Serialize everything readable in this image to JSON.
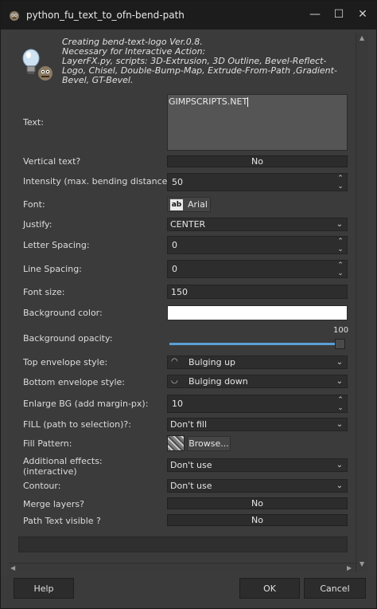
{
  "window": {
    "title": "python_fu_text_to_ofn-bend-path"
  },
  "info": {
    "text": "Creating bend-text-logo Ver.0.8.\nNecessary for Interactive Action:\nLayerFX.py, scripts: 3D-Extrusion, 3D Outline, Bevel-Reflect-\nLogo, Chisel, Double-Bump-Map, Extrude-From-Path ,Gradient-\nBevel, GT-Bevel."
  },
  "fields": {
    "text": {
      "label": "Text:",
      "value": "GIMPSCRIPTS.NET"
    },
    "vertical": {
      "label": "Vertical text?",
      "value": "No"
    },
    "intensity": {
      "label": "Intensity (max. bending distance):",
      "value": "50"
    },
    "font": {
      "label": "Font:",
      "icon_text": "ab",
      "value": "Arial"
    },
    "justify": {
      "label": "Justify:",
      "value": "CENTER"
    },
    "letter_spacing": {
      "label": "Letter Spacing:",
      "value": "0"
    },
    "line_spacing": {
      "label": "Line Spacing:",
      "value": "0"
    },
    "font_size": {
      "label": "Font size:",
      "value": "150"
    },
    "bg_color": {
      "label": "Background color:",
      "color": "#ffffff"
    },
    "bg_opacity": {
      "label": "Background opacity:",
      "value": "100",
      "level": 1.0
    },
    "top_env": {
      "label": "Top envelope style:",
      "value": "Bulging up"
    },
    "bottom_env": {
      "label": "Bottom envelope style:",
      "value": "Bulging down"
    },
    "enlarge_bg": {
      "label": "Enlarge BG (add margin-px):",
      "value": "10"
    },
    "fill": {
      "label": "FILL (path to selection)?:",
      "value": "Don't fill"
    },
    "fill_pattern": {
      "label": "Fill Pattern:",
      "button": "Browse..."
    },
    "additional": {
      "label": "Additional effects:\n (interactive)",
      "value": "Don't use"
    },
    "contour": {
      "label": "Contour:",
      "value": "Don't use"
    },
    "merge": {
      "label": "Merge layers?",
      "value": "No"
    },
    "path_visible": {
      "label": "Path Text visible ?",
      "value": "No"
    }
  },
  "buttons": {
    "help": "Help",
    "ok": "OK",
    "cancel": "Cancel"
  },
  "colors": {
    "accent": "#5a9fd6",
    "dialog_bg": "#3b3b3b",
    "titlebar_bg": "#1c1c1c"
  }
}
